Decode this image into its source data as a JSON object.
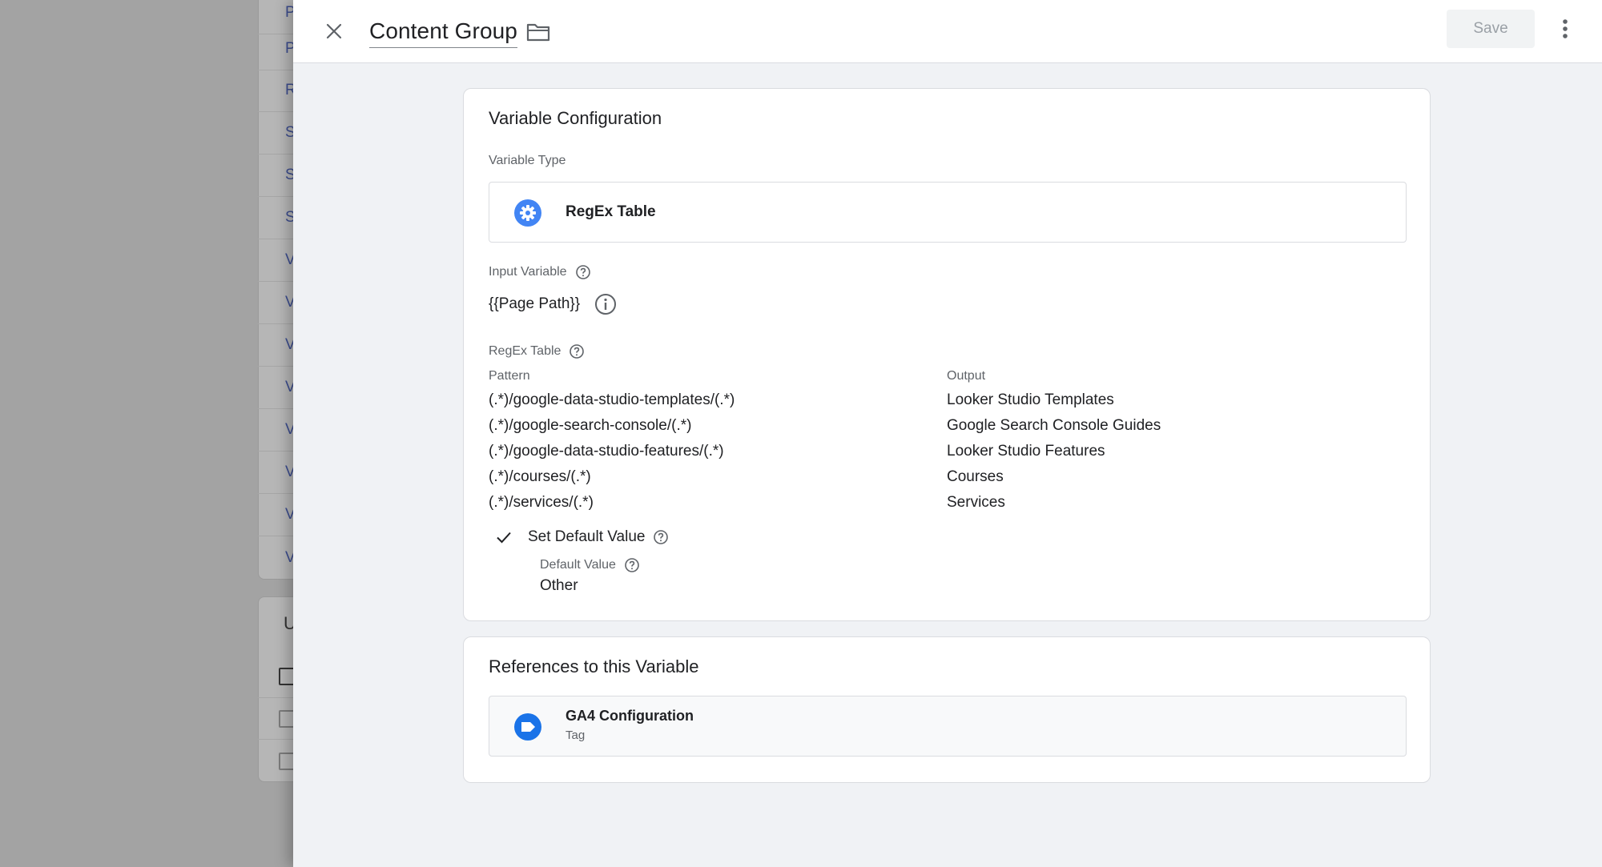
{
  "background": {
    "row_letters": [
      "P",
      "P",
      "R",
      "S",
      "S",
      "S",
      "V",
      "V",
      "V",
      "V",
      "V",
      "V",
      "V",
      "V"
    ],
    "second_card_letter": "U"
  },
  "header": {
    "title": "Content Group",
    "save_label": "Save"
  },
  "config": {
    "card_title": "Variable Configuration",
    "variable_type_label": "Variable Type",
    "variable_type": "RegEx Table",
    "input_variable_label": "Input Variable",
    "input_variable_value": "{{Page Path}}",
    "regex_table_label": "RegEx Table",
    "pattern_header": "Pattern",
    "output_header": "Output",
    "rows": [
      {
        "pattern": "(.*)/google-data-studio-templates/(.*)",
        "output": "Looker Studio Templates"
      },
      {
        "pattern": "(.*)/google-search-console/(.*)",
        "output": "Google Search Console Guides"
      },
      {
        "pattern": "(.*)/google-data-studio-features/(.*)",
        "output": "Looker Studio Features"
      },
      {
        "pattern": "(.*)/courses/(.*)",
        "output": "Courses"
      },
      {
        "pattern": "(.*)/services/(.*)",
        "output": "Services"
      }
    ],
    "set_default_label": "Set Default Value",
    "default_value_label": "Default Value",
    "default_value": "Other"
  },
  "references": {
    "card_title": "References to this Variable",
    "items": [
      {
        "name": "GA4 Configuration",
        "type": "Tag"
      }
    ]
  },
  "colors": {
    "accent": "#1a73e8",
    "icon_blue": "#4285f4"
  }
}
